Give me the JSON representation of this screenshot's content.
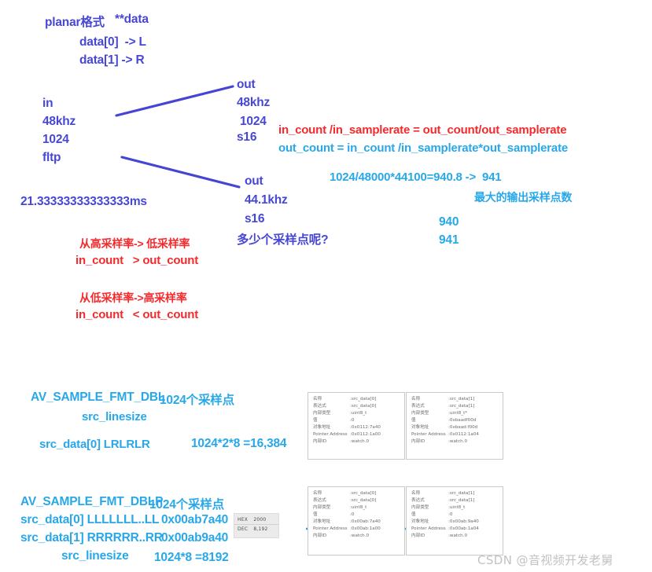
{
  "diagram": {
    "title_note": "planar格式",
    "title_note2": "**data",
    "data0": "data[0]  -> L",
    "data1": "data[1] -> R",
    "in_label": "in",
    "in_rate": "48khz",
    "in_count": "1024",
    "in_fmt": "fltp",
    "duration": "21.33333333333333ms",
    "out1_label": "out",
    "out1_rate": "48khz",
    "out1_count": "1024",
    "out1_fmt": "s16",
    "out2_label": "out",
    "out2_rate": "44.1khz",
    "out2_fmt": "s16",
    "question": "多少个采样点呢?"
  },
  "formulas": {
    "ratio": "in_count /in_samplerate = out_count/out_samplerate",
    "out_count": "out_count = in_count /in_samplerate*out_samplerate",
    "calc": "1024/48000*44100=940.8 ->  941",
    "max_note": "最大的输出采样点数",
    "val_940": "940",
    "val_941": "941"
  },
  "rules": {
    "high_to_low_title": "从高采样率-> 低采样率",
    "high_to_low_expr": "in_count   > out_count",
    "low_to_high_title": "从低采样率->高采样率",
    "low_to_high_expr": "in_count   < out_count"
  },
  "packed": {
    "fmt": "AV_SAMPLE_FMT_DBL",
    "samples": "1024个采样点",
    "linesize_label": "src_linesize",
    "data0": "src_data[0] LRLRLR",
    "size_calc": "1024*2*8 =16,384"
  },
  "planar": {
    "fmt": "AV_SAMPLE_FMT_DBLP",
    "samples": "1024个采样点",
    "data0": "src_data[0] LLLLLLL..LL",
    "data0_addr": "0x00ab7a40",
    "data1": "src_data[1] RRRRRR..RR",
    "data1_addr": "0x00ab9a40",
    "linesize_label": "src_linesize",
    "linesize_calc": "1024*8 =8192"
  },
  "hexdec": {
    "hex_label": "HEX",
    "hex_value": "2000",
    "dec_label": "DEC",
    "dec_value": "8,192"
  },
  "watch_panels": [
    {
      "id": "packed-src-data-0",
      "rows": [
        {
          "key": "名称",
          "value": ":src_data[0]"
        },
        {
          "key": "表达式",
          "value": ":src_data[0]"
        },
        {
          "key": "内部类型",
          "value": ":uint8_t"
        },
        {
          "key": "值",
          "value": ":0"
        },
        {
          "key": "对象地址",
          "value": ":0x0112:7a40"
        },
        {
          "key": "Pointer Address",
          "value": ":0x0112:1a00"
        },
        {
          "key": "内部ID",
          "value": ":watch.0"
        }
      ]
    },
    {
      "id": "packed-src-data-1",
      "rows": [
        {
          "key": "名称",
          "value": ":src_data[1]"
        },
        {
          "key": "表达式",
          "value": ":src_data[1]"
        },
        {
          "key": "内部类型",
          "value": ":uint8_t*"
        },
        {
          "key": "值",
          "value": ":0xbaadf00d"
        },
        {
          "key": "对象地址",
          "value": ":0xbaad:f00d"
        },
        {
          "key": "Pointer Address",
          "value": ":0x0112:1a04"
        },
        {
          "key": "内部ID",
          "value": ":watch.0"
        }
      ]
    },
    {
      "id": "planar-src-data-0",
      "rows": [
        {
          "key": "名称",
          "value": ":src_data[0]"
        },
        {
          "key": "表达式",
          "value": ":src_data[0]"
        },
        {
          "key": "内部类型",
          "value": ":uint8_t"
        },
        {
          "key": "值",
          "value": ":0"
        },
        {
          "key": "对象地址",
          "value": ":0x00ab:7a40"
        },
        {
          "key": "Pointer Address",
          "value": ":0x00ab:1a00"
        },
        {
          "key": "内部ID",
          "value": ":watch.0"
        }
      ]
    },
    {
      "id": "planar-src-data-1",
      "rows": [
        {
          "key": "名称",
          "value": ":src_data[1]"
        },
        {
          "key": "表达式",
          "value": ":src_data[1]"
        },
        {
          "key": "内部类型",
          "value": ":uint8_t"
        },
        {
          "key": "值",
          "value": ":0"
        },
        {
          "key": "对象地址",
          "value": ":0x00ab:9a40"
        },
        {
          "key": "Pointer Address",
          "value": ":0x00ab:1a04"
        },
        {
          "key": "内部ID",
          "value": ":watch.0"
        }
      ]
    }
  ],
  "watermark": "CSDN @音视频开发老舅",
  "colors": {
    "blue": "#4747d6",
    "red": "#f42a2c",
    "cyan": "#28a8e8",
    "panel_border": "#c9c9c9",
    "panel_text": "#6b6b6b",
    "watermark": "#c2c2c2"
  }
}
